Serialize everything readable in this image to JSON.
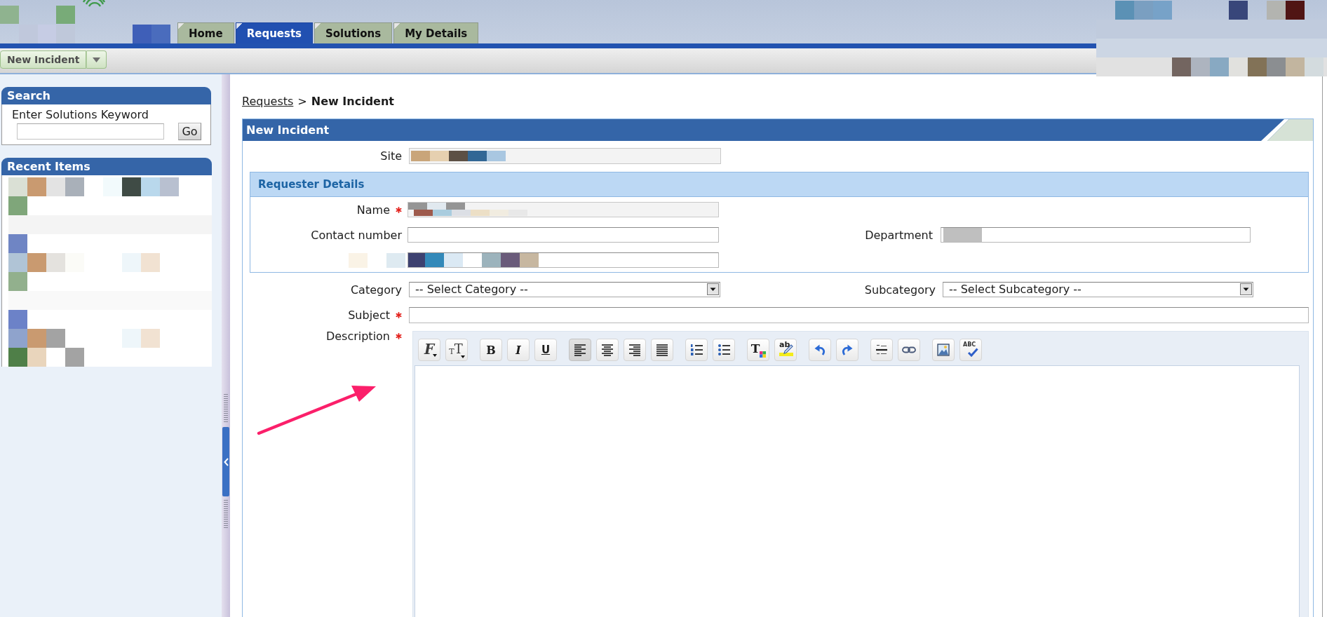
{
  "header": {
    "tabs": [
      {
        "label": "Home",
        "selected": false
      },
      {
        "label": "Requests",
        "selected": true
      },
      {
        "label": "Solutions",
        "selected": false
      },
      {
        "label": "My Details",
        "selected": false
      }
    ]
  },
  "toolbar": {
    "new_button": "New Incident"
  },
  "sidebar": {
    "search": {
      "title": "Search",
      "prompt": "Enter Solutions Keyword",
      "button": "Go"
    },
    "recent_items": {
      "title": "Recent Items"
    }
  },
  "breadcrumb": {
    "link": "Requests",
    "separator": ">",
    "current": "New Incident"
  },
  "form": {
    "title": "New Incident",
    "site": {
      "label": "Site",
      "required": false
    },
    "requester_details": {
      "title": "Requester Details",
      "name": {
        "label": "Name",
        "required": true
      },
      "contact_number": {
        "label": "Contact number",
        "required": false
      },
      "department": {
        "label": "Department",
        "required": false
      }
    },
    "category": {
      "label": "Category",
      "required": false,
      "value": "-- Select Category --"
    },
    "subcategory": {
      "label": "Subcategory",
      "required": false,
      "value": "-- Select Subcategory --"
    },
    "subject": {
      "label": "Subject",
      "required": true
    },
    "description": {
      "label": "Description",
      "required": true,
      "toolbar": [
        [
          {
            "kind": "font",
            "label": "F"
          },
          {
            "kind": "font-size",
            "small_label": "T",
            "label": "T"
          }
        ],
        [
          {
            "kind": "bold",
            "label": "B"
          },
          {
            "kind": "italic",
            "label": "I"
          },
          {
            "kind": "underline",
            "label": "U"
          }
        ],
        [
          {
            "kind": "align-left",
            "selected": true
          },
          {
            "kind": "align-center",
            "selected": false
          },
          {
            "kind": "align-right",
            "selected": false
          },
          {
            "kind": "justify",
            "selected": false
          }
        ],
        [
          {
            "kind": "numbered-list"
          },
          {
            "kind": "bullet-list"
          }
        ],
        [
          {
            "kind": "text-color",
            "label": "T"
          },
          {
            "kind": "highlight",
            "label": "ab"
          }
        ],
        [
          {
            "kind": "undo"
          },
          {
            "kind": "redo"
          }
        ],
        [
          {
            "kind": "horizontal-rule"
          },
          {
            "kind": "link"
          }
        ],
        [
          {
            "kind": "image"
          },
          {
            "kind": "spellcheck",
            "label": "ABC"
          }
        ]
      ]
    }
  }
}
